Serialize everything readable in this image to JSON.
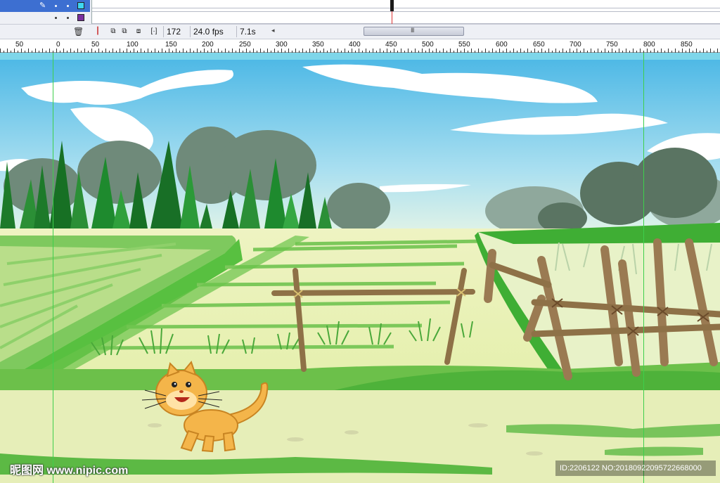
{
  "timeline": {
    "layers": [
      {
        "icons": [
          "pencil-icon",
          "eye-dot",
          "lock-dot"
        ],
        "color": "#3fd6f0"
      },
      {
        "icons": [
          "eye-dot",
          "lock-dot"
        ],
        "color": "#7a2fa0"
      }
    ],
    "controls": {
      "current_frame": "172",
      "fps": "24.0 fps",
      "elapsed": "7.1s",
      "scroll_grip": "III"
    }
  },
  "ruler": {
    "labels": [
      "50",
      "0",
      "50",
      "100",
      "150",
      "200",
      "250",
      "300",
      "350",
      "400",
      "450",
      "500",
      "550",
      "600",
      "650",
      "700",
      "750",
      "800",
      "850"
    ]
  },
  "stage": {
    "scene": "rural field with fence, trees and a cartoon cat",
    "colors": {
      "sky": "#5cc4e8",
      "grass": "#4caf2a",
      "field": "#e8f0b0",
      "fence": "#9a7a52",
      "cat": "#f4b54a"
    }
  },
  "watermark": {
    "site": "昵图网 www.nipic.com",
    "id": "ID:2206122 NO:20180922095722668000"
  }
}
